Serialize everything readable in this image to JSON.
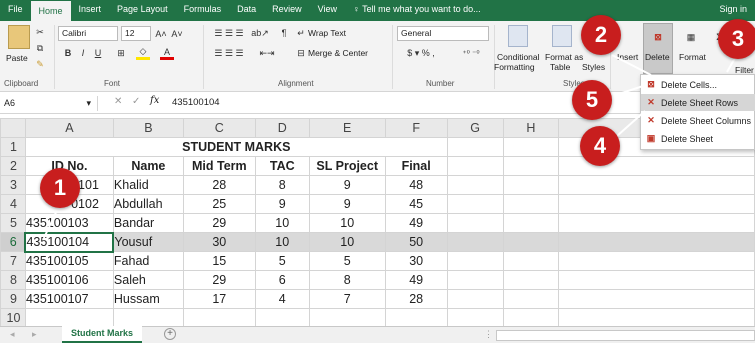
{
  "tabs": [
    "File",
    "Home",
    "Insert",
    "Page Layout",
    "Formulas",
    "Data",
    "Review",
    "View"
  ],
  "tell_me": "Tell me what you want to do...",
  "sign_in": "Sign in",
  "ribbon": {
    "paste": "Paste",
    "clipboard": "Clipboard",
    "font_name": "Calibri",
    "font_size": "12",
    "font_group": "Font",
    "wrap_text": "Wrap Text",
    "merge_center": "Merge & Center",
    "alignment": "Alignment",
    "number_format": "General",
    "number": "Number",
    "conditional": "Conditional",
    "formatting": "Formatting",
    "format_as": "Format as",
    "table": "Table",
    "styles_btn": "Styles",
    "styles": "Styles",
    "insert": "Insert",
    "delete": "Delete",
    "format": "Format",
    "filter": "Filter"
  },
  "formula_bar": {
    "cell_ref": "A6",
    "fx": "fx",
    "value": "435100104"
  },
  "columns": [
    "A",
    "B",
    "C",
    "D",
    "E",
    "F",
    "G",
    "H"
  ],
  "rows": [
    {
      "num": "1",
      "cells": [
        "STUDENT MARKS"
      ]
    },
    {
      "num": "2",
      "cells": [
        "ID No.",
        "Name",
        "Mid Term",
        "TAC",
        "SL Project",
        "Final"
      ]
    },
    {
      "num": "3",
      "cells": [
        "101",
        "Khalid",
        "28",
        "8",
        "9",
        "48"
      ]
    },
    {
      "num": "4",
      "cells": [
        "0102",
        "Abdullah",
        "25",
        "9",
        "9",
        "45"
      ]
    },
    {
      "num": "5",
      "cells": [
        "435100103",
        "Bandar",
        "29",
        "10",
        "10",
        "49"
      ]
    },
    {
      "num": "6",
      "cells": [
        "435100104",
        "Yousuf",
        "30",
        "10",
        "10",
        "50"
      ]
    },
    {
      "num": "7",
      "cells": [
        "435100105",
        "Fahad",
        "15",
        "5",
        "5",
        "30"
      ]
    },
    {
      "num": "8",
      "cells": [
        "435100106",
        "Saleh",
        "29",
        "6",
        "8",
        "49"
      ]
    },
    {
      "num": "9",
      "cells": [
        "435100107",
        "Hussam",
        "17",
        "4",
        "7",
        "28"
      ]
    },
    {
      "num": "10",
      "cells": []
    }
  ],
  "sheet_tab": "Student Marks",
  "menu": [
    "Delete Cells...",
    "Delete Sheet Rows",
    "Delete Sheet Columns",
    "Delete Sheet"
  ],
  "callouts": [
    "1",
    "2",
    "3",
    "4",
    "5"
  ],
  "colors": {
    "excel_green": "#217346",
    "callout_red": "#c81e1e"
  }
}
